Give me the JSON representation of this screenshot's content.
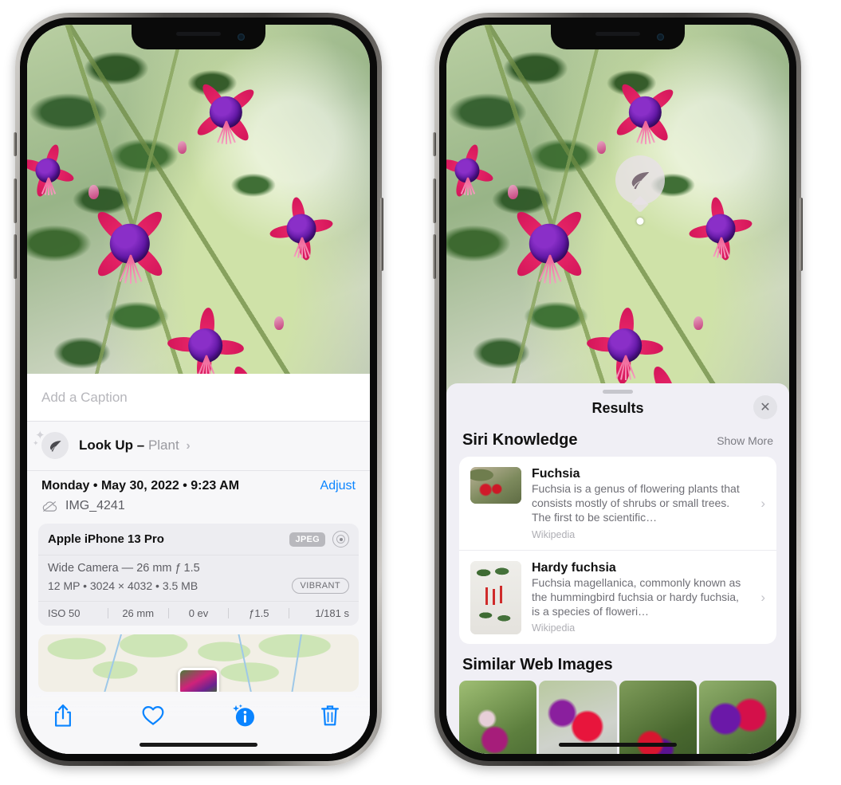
{
  "left_phone": {
    "caption_placeholder": "Add a Caption",
    "lookup": {
      "label": "Look Up",
      "dash": "–",
      "subject": "Plant",
      "chevron": "›",
      "icon": "leaf-icon"
    },
    "date": "Monday • May 30, 2022 • 9:23 AM",
    "adjust_label": "Adjust",
    "filename": "IMG_4241",
    "metadata": {
      "device": "Apple iPhone 13 Pro",
      "format_badge": "JPEG",
      "lens": "Wide Camera — 26 mm ƒ 1.5",
      "specs": "12 MP • 3024 × 4032 • 3.5 MB",
      "style_badge": "VIBRANT",
      "exif": [
        "ISO 50",
        "26 mm",
        "0 ev",
        "ƒ1.5",
        "1/181 s"
      ]
    },
    "toolbar": [
      {
        "name": "share-button",
        "icon": "share-icon"
      },
      {
        "name": "favorite-button",
        "icon": "heart-icon"
      },
      {
        "name": "info-button",
        "icon": "info-sparkle-icon"
      },
      {
        "name": "delete-button",
        "icon": "trash-icon"
      }
    ]
  },
  "right_phone": {
    "pin_icon": "leaf-icon",
    "sheet_title": "Results",
    "close_icon": "close-icon",
    "siri_section": {
      "title": "Siri Knowledge",
      "action": "Show More"
    },
    "knowledge_items": [
      {
        "title": "Fuchsia",
        "description": "Fuchsia is a genus of flowering plants that consists mostly of shrubs or small trees. The first to be scientific…",
        "source": "Wikipedia"
      },
      {
        "title": "Hardy fuchsia",
        "description": "Fuchsia magellanica, commonly known as the hummingbird fuchsia or hardy fuchsia, is a species of floweri…",
        "source": "Wikipedia"
      }
    ],
    "web_section": {
      "title": "Similar Web Images"
    },
    "web_images": [
      "thumb-1",
      "thumb-2",
      "thumb-3",
      "thumb-4"
    ]
  },
  "colors": {
    "accent": "#0a84ff",
    "sheet_bg": "#f0eff5",
    "panel_bg": "#f7f7f9"
  }
}
